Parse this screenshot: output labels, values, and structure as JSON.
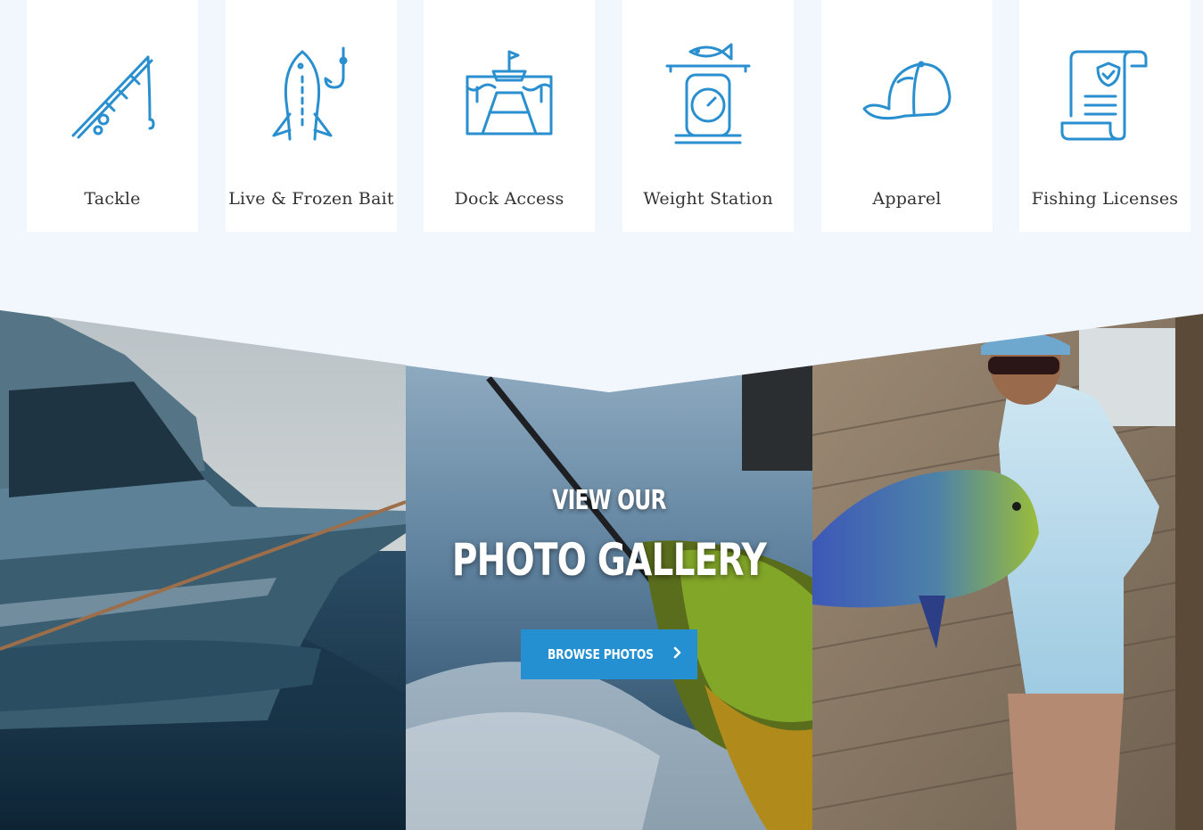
{
  "services": [
    {
      "label": "Tackle",
      "icon": "fishing-rod-icon"
    },
    {
      "label": "Live & Frozen Bait",
      "icon": "fish-hook-icon"
    },
    {
      "label": "Dock Access",
      "icon": "dock-icon"
    },
    {
      "label": "Weight Station",
      "icon": "scale-icon"
    },
    {
      "label": "Apparel",
      "icon": "cap-icon"
    },
    {
      "label": "Fishing Licenses",
      "icon": "license-scroll-icon"
    }
  ],
  "gallery": {
    "subtitle": "VIEW OUR",
    "title": "PHOTO GALLERY",
    "button_label": "BROWSE PHOTOS",
    "button_icon": "chevron-right-icon"
  },
  "colors": {
    "accent": "#2490d1",
    "icon_stroke": "#2a8fcf",
    "background": "#f2f6fd"
  }
}
